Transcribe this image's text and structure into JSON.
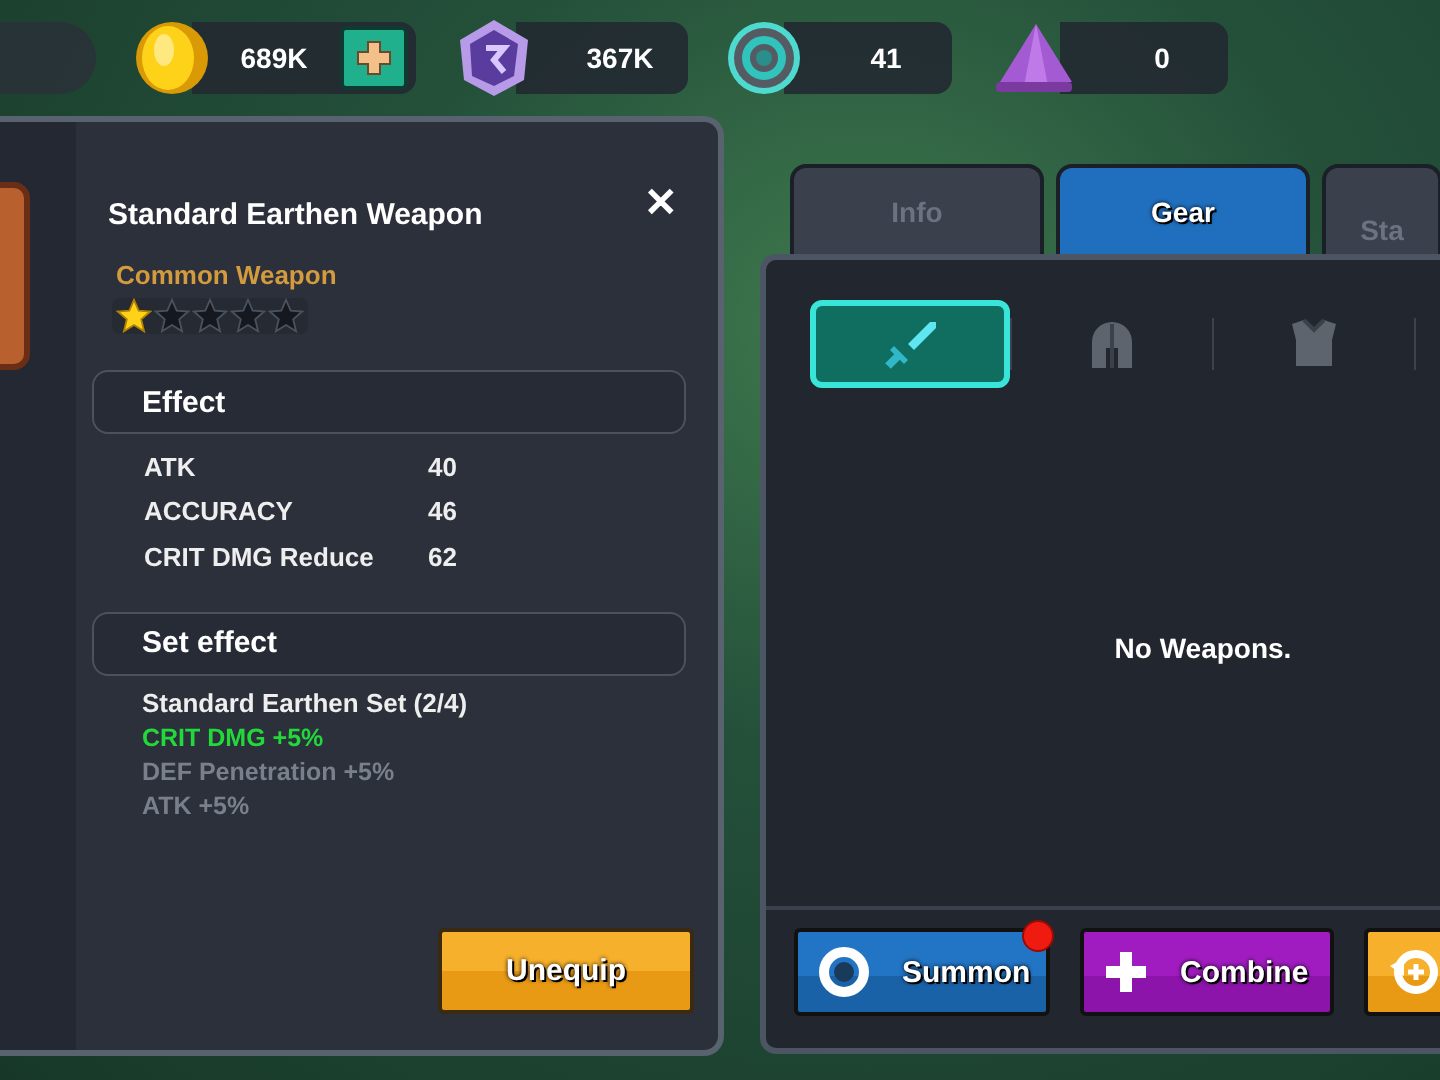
{
  "currencies": [
    {
      "kind": "coin",
      "value": "689K",
      "add_button": true
    },
    {
      "kind": "gem",
      "value": "367K",
      "add_button": false
    },
    {
      "kind": "ring",
      "value": "41",
      "add_button": false
    },
    {
      "kind": "crystal",
      "value": "0",
      "add_button": false
    }
  ],
  "item_panel": {
    "close": "✕",
    "title": "Standard Earthen Weapon",
    "rarity": "Common Weapon",
    "stars": 1,
    "effect": {
      "heading": "Effect",
      "stats": [
        {
          "name": "ATK",
          "value": "40"
        },
        {
          "name": "ACCURACY",
          "value": "46"
        },
        {
          "name": "CRIT DMG Reduce",
          "value": "62"
        }
      ]
    },
    "set_effect": {
      "heading": "Set effect",
      "set_name": "Standard Earthen Set (2/4)",
      "bonuses": [
        {
          "text": "CRIT DMG +5%",
          "active": true
        },
        {
          "text": "DEF Penetration +5%",
          "active": false
        },
        {
          "text": "ATK +5%",
          "active": false
        }
      ]
    },
    "unequip_button": "Unequip"
  },
  "tabs": [
    {
      "label": "Info",
      "selected": false
    },
    {
      "label": "Gear",
      "selected": true
    },
    {
      "label": "Sta",
      "selected": false
    }
  ],
  "gear_panel": {
    "slots": [
      {
        "kind": "sword",
        "selected": true
      },
      {
        "kind": "helmet",
        "selected": false
      },
      {
        "kind": "armor",
        "selected": false
      }
    ],
    "empty_message": "No Weapons.",
    "buttons": [
      {
        "kind": "summon",
        "label": "Summon",
        "notification": true
      },
      {
        "kind": "combine",
        "label": "Combine",
        "notification": false
      },
      {
        "kind": "upgrade",
        "notification": false
      }
    ]
  }
}
